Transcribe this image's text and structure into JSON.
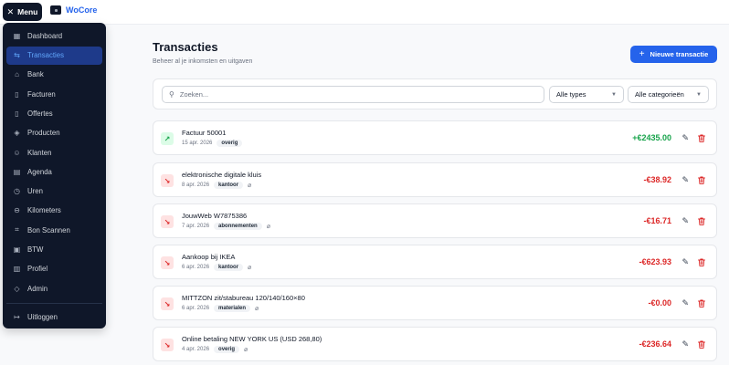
{
  "topbar": {
    "menu_label": "Menu",
    "brand_name": "WoCore"
  },
  "sidebar": {
    "items": [
      {
        "label": "Dashboard",
        "icon": "grid-icon",
        "glyph": "▦"
      },
      {
        "label": "Transacties",
        "icon": "swap-icon",
        "glyph": "⇆"
      },
      {
        "label": "Bank",
        "icon": "bank-icon",
        "glyph": "⌂"
      },
      {
        "label": "Facturen",
        "icon": "file-icon",
        "glyph": "▯"
      },
      {
        "label": "Offertes",
        "icon": "document-icon",
        "glyph": "▯"
      },
      {
        "label": "Producten",
        "icon": "box-icon",
        "glyph": "◈"
      },
      {
        "label": "Klanten",
        "icon": "users-icon",
        "glyph": "☺"
      },
      {
        "label": "Agenda",
        "icon": "calendar-icon",
        "glyph": "▤"
      },
      {
        "label": "Uren",
        "icon": "clock-icon",
        "glyph": "◷"
      },
      {
        "label": "Kilometers",
        "icon": "car-icon",
        "glyph": "⊖"
      },
      {
        "label": "Bon Scannen",
        "icon": "scan-icon",
        "glyph": "⌗"
      },
      {
        "label": "BTW",
        "icon": "calculator-icon",
        "glyph": "▣"
      },
      {
        "label": "Profiel",
        "icon": "building-icon",
        "glyph": "▥"
      },
      {
        "label": "Admin",
        "icon": "shield-icon",
        "glyph": "◇"
      }
    ],
    "active_index": 1,
    "logout_label": "Uitloggen",
    "logout_glyph": "↦"
  },
  "header": {
    "title": "Transacties",
    "subtitle": "Beheer al je inkomsten en uitgaven",
    "new_button_label": "Nieuwe transactie"
  },
  "filters": {
    "search_placeholder": "Zoeken...",
    "type_selected": "Alle types",
    "category_selected": "Alle categorieën"
  },
  "transactions": [
    {
      "title": "Factuur 50001",
      "date": "15 apr. 2026",
      "tag": "overig",
      "amount": "+€2435.00",
      "direction": "in",
      "attachment": false
    },
    {
      "title": "elektronische digitale kluis",
      "date": "8 apr. 2026",
      "tag": "kantoor",
      "amount": "-€38.92",
      "direction": "out",
      "attachment": true
    },
    {
      "title": "JouwWeb W7875386",
      "date": "7 apr. 2026",
      "tag": "abonnementen",
      "amount": "-€16.71",
      "direction": "out",
      "attachment": true
    },
    {
      "title": "Aankoop bij IKEA",
      "date": "6 apr. 2026",
      "tag": "kantoor",
      "amount": "-€623.93",
      "direction": "out",
      "attachment": true
    },
    {
      "title": "MITTZON zit/stabureau 120/140/160×80",
      "date": "6 apr. 2026",
      "tag": "materialen",
      "amount": "-€0.00",
      "direction": "out",
      "attachment": true
    },
    {
      "title": "Online betaling NEW YORK US (USD 268,80)",
      "date": "4 apr. 2026",
      "tag": "overig",
      "amount": "-€236.64",
      "direction": "out",
      "attachment": true
    }
  ],
  "colors": {
    "sidebar_bg": "#0f1729",
    "accent": "#2563eb",
    "income": "#16a34a",
    "expense": "#dc2626"
  }
}
